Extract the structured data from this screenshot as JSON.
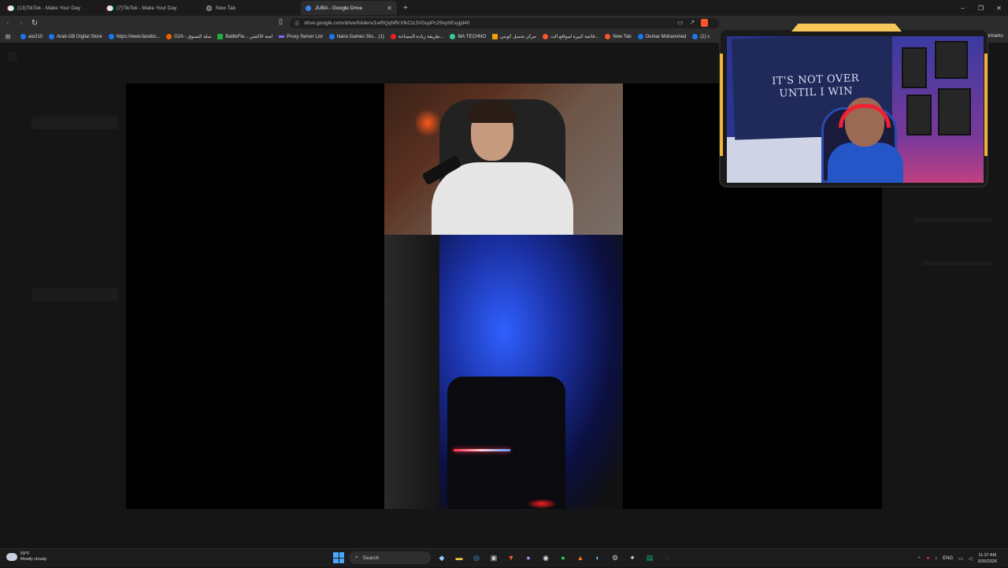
{
  "tabs": [
    {
      "title": "(13)TikTok - Make Your Day",
      "active": false,
      "icon": "tiktok-icon"
    },
    {
      "title": "(7)TikTok - Make Your Day",
      "active": false,
      "icon": "tiktok-icon"
    },
    {
      "title": "New Tab",
      "active": false,
      "icon": "brave-icon"
    },
    {
      "title": "JUBA - Google Drive",
      "active": true,
      "icon": "google-drive-icon"
    }
  ],
  "new_tab_symbol": "+",
  "window_controls": {
    "minimize": "–",
    "restore": "❐",
    "close": "✕"
  },
  "address": {
    "url": "drive.google.com/drive/folders/1wRQqNRrXfkCtzJVGupPc29vyhEsyjjd40"
  },
  "bookmarks": [
    {
      "label": "aio210",
      "icon": "facebook-icon"
    },
    {
      "label": "Arab-GB Digital Store",
      "icon": "facebook-icon"
    },
    {
      "label": "https://www.facebo...",
      "icon": "facebook-icon"
    },
    {
      "label": "G2A - سلة التسوق",
      "icon": "g2a-icon"
    },
    {
      "label": "BattleFie... لعبة الاكشن",
      "icon": "battlefield-icon"
    },
    {
      "label": "Proxy Server List",
      "icon": "proxy-icon"
    },
    {
      "label": "Nano Games Sto... (1)",
      "icon": "facebook-icon"
    },
    {
      "label": "طريقة زيادة المساحة...",
      "icon": "youtube-icon"
    },
    {
      "label": "MA TECHNO",
      "icon": "ma-icon"
    },
    {
      "label": "مركز تحميل كويتي",
      "icon": "download-icon"
    },
    {
      "label": "قائمة كبيرة لمواقع الت...",
      "icon": "star-icon"
    },
    {
      "label": "New Tab",
      "icon": "brave-icon"
    },
    {
      "label": "Oumar Mohammed",
      "icon": "facebook-icon"
    },
    {
      "label": "(1) s",
      "icon": "facebook-icon"
    }
  ],
  "all_bookmarks_label": "okmarks",
  "overlay": {
    "banner_line1": "IT'S NOT OVER",
    "banner_line2": "UNTIL I WIN"
  },
  "taskbar": {
    "weather_temp": "59°F",
    "weather_desc": "Mostly cloudy",
    "search_label": "Search",
    "language": "ENG",
    "time": "11:37 AM",
    "date": "3/26/2026"
  },
  "colors": {
    "accent_gold": "#f2b33a",
    "taskbar_bg": "#1c1c1c",
    "browser_bg": "#2c2c2c"
  }
}
